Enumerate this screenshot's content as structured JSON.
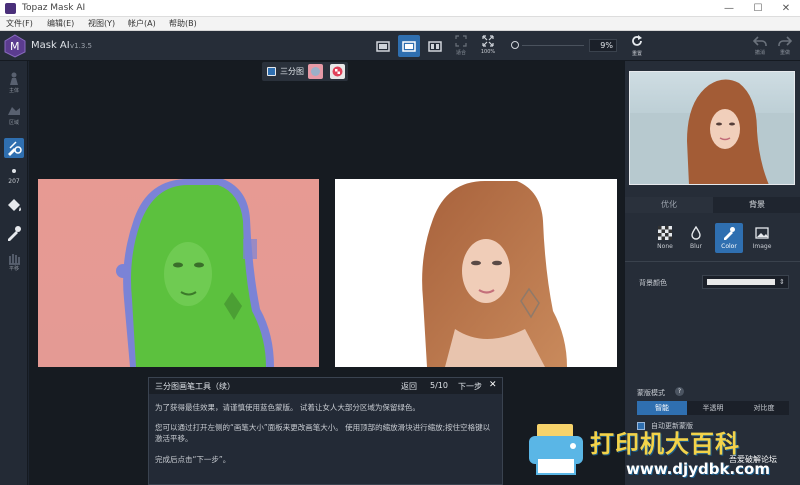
{
  "window": {
    "title": "Topaz Mask AI",
    "minimize": "—",
    "maximize": "☐",
    "close": "✕"
  },
  "menu": [
    "文件(F)",
    "编辑(E)",
    "视图(Y)",
    "帐户(A)",
    "帮助(B)"
  ],
  "app": {
    "name": "Mask AI",
    "version": "v1.3.5"
  },
  "toolbar": {
    "fit_label": "适合",
    "zoom_label": "100%",
    "zoom_value": "9%",
    "reset_label": "重置",
    "undo_label": "撤消",
    "redo_label": "重做"
  },
  "left_tools": {
    "brush_size": "207",
    "labels": [
      "主体",
      "区域",
      "",
      "",
      "",
      "",
      "平移"
    ]
  },
  "view_toggle": {
    "label": "三分图"
  },
  "right_panel": {
    "tabs": [
      "优化",
      "背景"
    ],
    "bg_options": [
      "None",
      "Blur",
      "Color",
      "Image"
    ],
    "bg_color_label": "背景颜色",
    "mask_mode_label": "蒙版模式",
    "mask_modes": [
      "智能",
      "半透明",
      "对比度"
    ],
    "auto_update_label": "自动更新蒙版"
  },
  "tutorial": {
    "title": "三分图画笔工具（续）",
    "back": "返回",
    "step": "5/10",
    "next": "下一步",
    "close": "✕",
    "body": [
      "为了获得最佳效果，请谨慎使用蓝色蒙版。 试着让女人大部分区域为保留绿色。",
      "您可以通过打开左侧的“画笔大小”面板来更改画笔大小。 使用顶部的缩放滑块进行缩放;按住空格键以激活平移。",
      "完成后点击“下一步”。"
    ]
  },
  "watermark": {
    "title": "打印机大百科",
    "url": "www.djydbk.com",
    "sub": "吾爱破解论坛"
  }
}
